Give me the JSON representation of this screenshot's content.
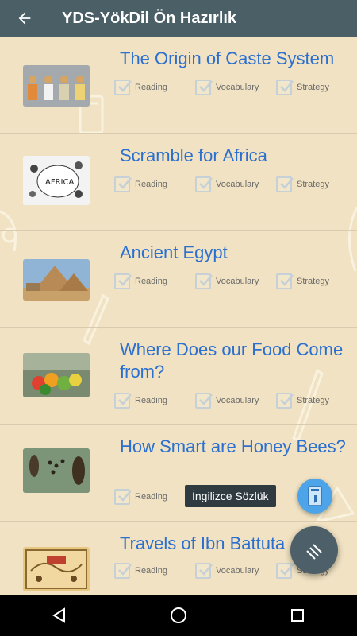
{
  "app_bar": {
    "back_icon": "arrow-left-icon",
    "title": "YDS-YökDil Ön Hazırlık"
  },
  "checkbox_labels": [
    "Reading",
    "Vocabulary",
    "Strategy"
  ],
  "lessons": [
    {
      "title": "The Origin of Caste System",
      "thumbnail": "caste-system-illustration"
    },
    {
      "title": "Scramble for Africa",
      "thumbnail": "africa-cartoon-illustration"
    },
    {
      "title": "Ancient Egypt",
      "thumbnail": "pyramids-photo"
    },
    {
      "title": "Where Does our Food Come from?",
      "thumbnail": "food-cart-photo"
    },
    {
      "title": "How Smart are Honey Bees?",
      "thumbnail": "bees-photo"
    },
    {
      "title": "Travels of Ibn Battuta",
      "thumbnail": "old-map-illustration"
    }
  ],
  "tooltip": {
    "text": "İngilizce Sözlük"
  },
  "fab_mini": {
    "icon": "dictionary-book-icon"
  },
  "fab_main": {
    "icon": "menu-lines-icon"
  },
  "nav_bar": {
    "back": "back-triangle-icon",
    "home": "home-circle-icon",
    "recents": "recents-square-icon"
  },
  "colors": {
    "app_bar": "#4a5f66",
    "background": "#f0e2c2",
    "title_text": "#2b6fd0",
    "fab_mini": "#4da4e8",
    "fab_main": "#4d5f68"
  }
}
